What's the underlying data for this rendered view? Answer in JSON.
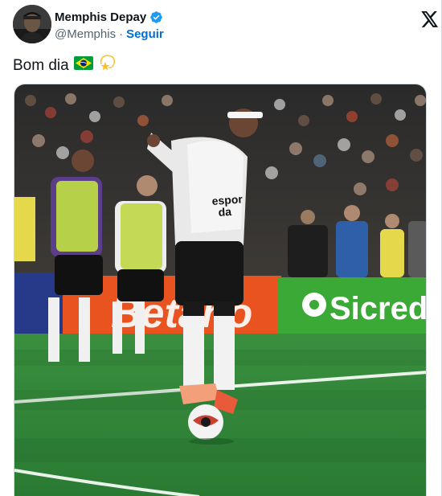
{
  "author": {
    "name": "Memphis Depay",
    "handle": "@Memphis",
    "separator": "·",
    "follow_label": "Seguir",
    "verified": true
  },
  "tweet": {
    "text": "Bom dia"
  },
  "media": {
    "ad_boards": [
      "Sicredi",
      "Betano"
    ],
    "kit_text": [
      "espor",
      "da"
    ]
  },
  "icons": {
    "verified": "verified-badge-icon",
    "x_logo": "x-logo-icon",
    "emoji_1": "brazil-flag-emoji",
    "emoji_2": "dizzy-star-emoji"
  },
  "colors": {
    "link": "#006fd6",
    "verified": "#1d9bf0",
    "pitch": "#2f8a3d",
    "sicredi": "#3aa935"
  }
}
